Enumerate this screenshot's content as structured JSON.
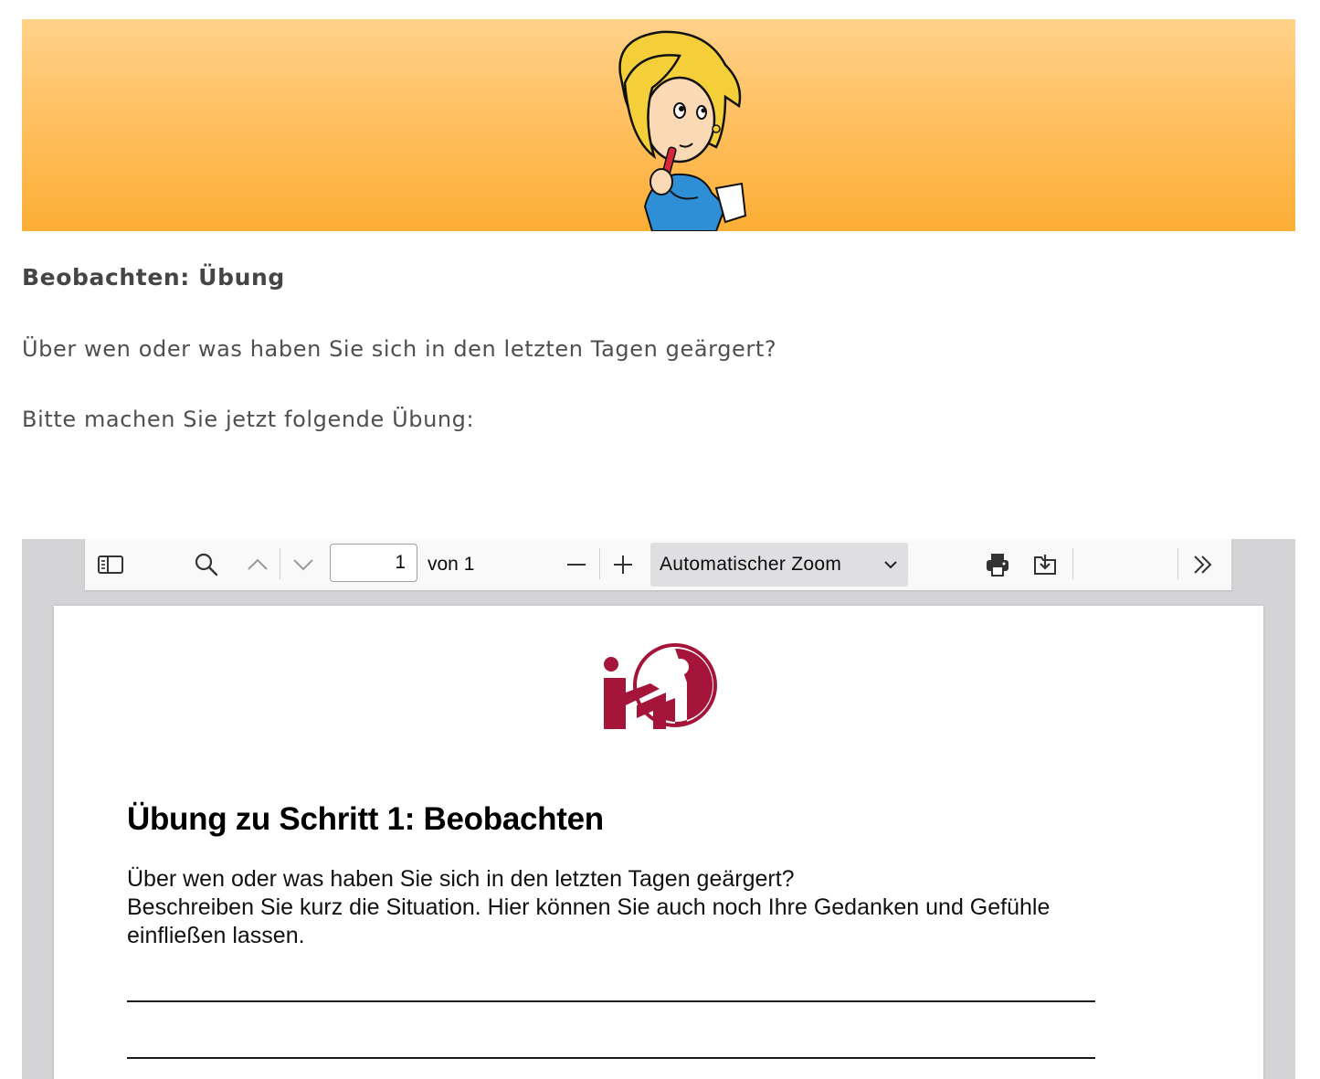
{
  "banner": {
    "illustration": "thinking-woman-illustration"
  },
  "page": {
    "heading": "Beobachten: Übung",
    "question": "Über wen oder was haben Sie sich in den letzten Tagen geärgert?",
    "instruction": "Bitte machen Sie jetzt folgende Übung:"
  },
  "pdf_viewer": {
    "toolbar": {
      "sidebar_toggle_icon": "sidebar-icon",
      "search_icon": "search-icon",
      "prev_icon": "chevron-up-icon",
      "next_icon": "chevron-down-icon",
      "page_value": "1",
      "page_of": "von 1",
      "zoom_out_icon": "minus-icon",
      "zoom_in_icon": "plus-icon",
      "zoom_value": "Automatischer Zoom",
      "print_icon": "printer-icon",
      "download_icon": "download-icon",
      "tools_icon": "double-chevron-right-icon"
    },
    "document": {
      "logo": "imi-logo",
      "logo_color": "#a5153a",
      "title": "Übung zu Schritt 1: Beobachten",
      "lines": [
        "Über wen oder was haben Sie sich in den letzten Tagen geärgert?",
        "Beschreiben Sie kurz die Situation. Hier können Sie auch noch Ihre Gedanken und Gefühle",
        "einfließen lassen."
      ]
    }
  }
}
